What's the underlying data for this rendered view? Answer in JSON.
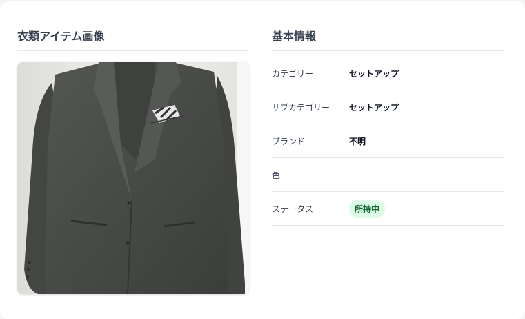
{
  "image_section": {
    "title": "衣類アイテム画像",
    "image_alt": "セットアップ ジャケット"
  },
  "info_section": {
    "title": "基本情報",
    "rows": [
      {
        "label": "カテゴリー",
        "value": "セットアップ"
      },
      {
        "label": "サブカテゴリー",
        "value": "セットアップ"
      },
      {
        "label": "ブランド",
        "value": "不明"
      },
      {
        "label": "色",
        "value": ""
      },
      {
        "label": "ステータス",
        "value": "所持中"
      }
    ]
  },
  "colors": {
    "status_badge_bg": "#dcfce7",
    "status_badge_text": "#166534",
    "jacket": "#4a4c4a"
  }
}
